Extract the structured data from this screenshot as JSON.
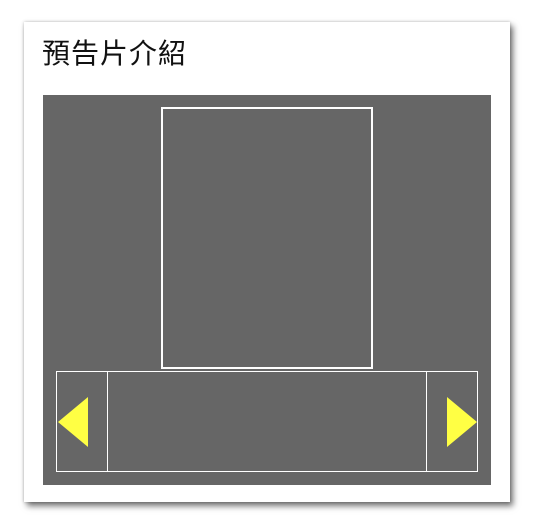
{
  "widget": {
    "title": "預告片介紹"
  },
  "colors": {
    "viewer_background": "#666666",
    "frame_border": "#ffffff",
    "arrow_fill": "#ffff44"
  },
  "icons": {
    "prev": "triangle-left-icon",
    "next": "triangle-right-icon"
  }
}
